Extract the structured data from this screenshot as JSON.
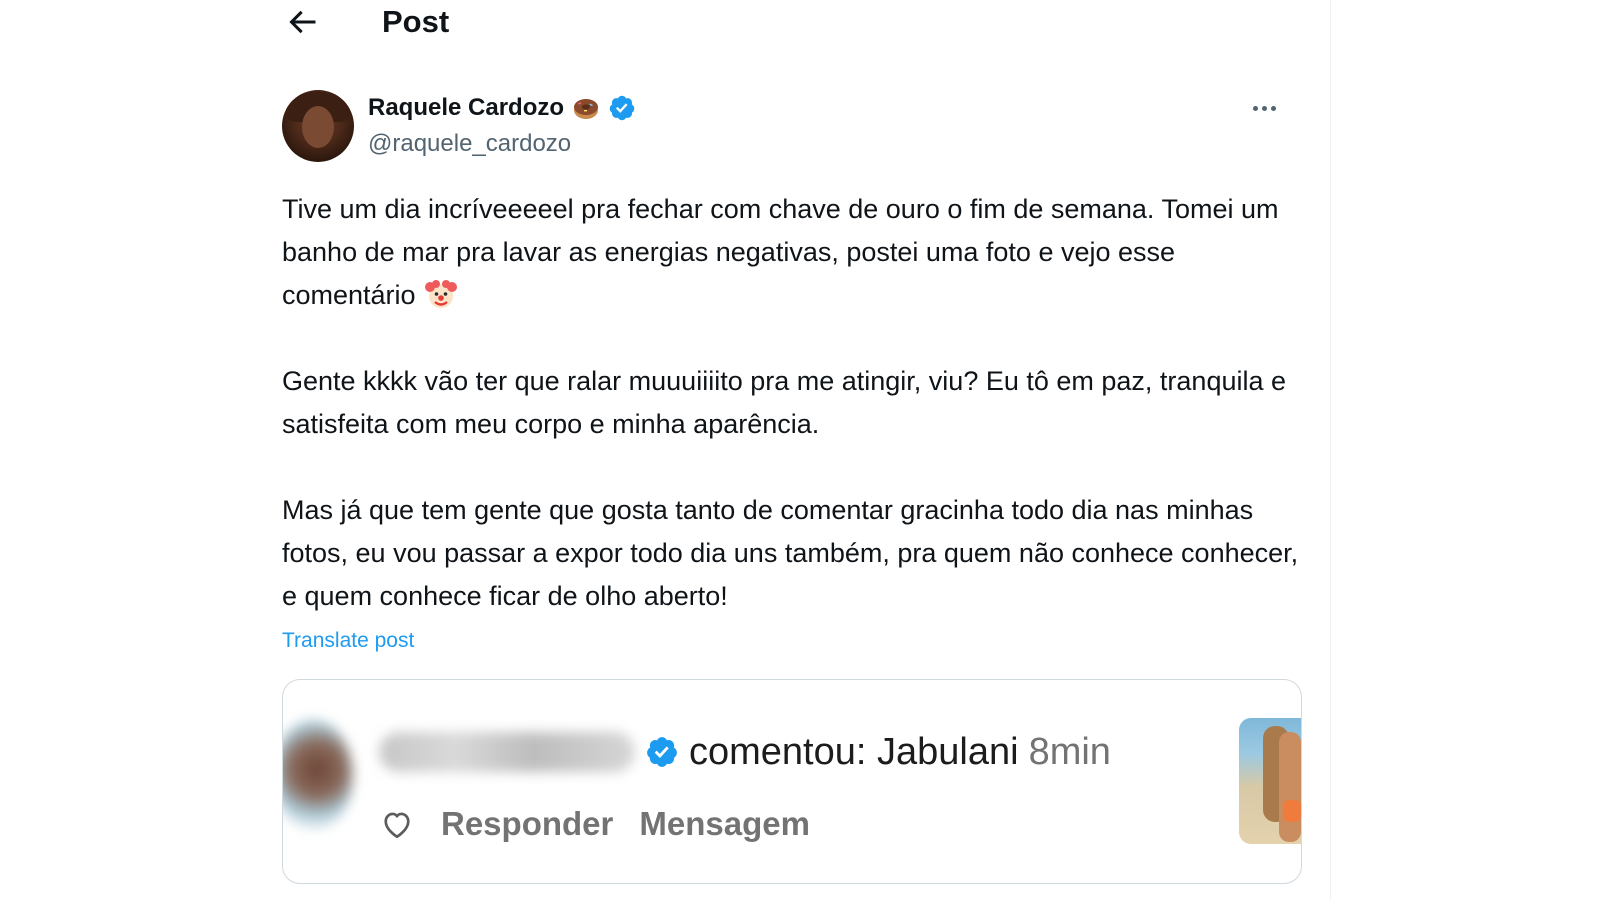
{
  "header": {
    "title": "Post",
    "back_icon": "arrow-left-icon"
  },
  "author": {
    "display_name": "Raquele Cardozo",
    "name_emoji": "donut-icon",
    "verified": true,
    "handle": "@raquele_cardozo",
    "more_icon": "more-horizontal-icon"
  },
  "post": {
    "paragraphs": [
      "Tive um dia incríveeeeel pra fechar com chave de ouro o fim de semana. Tomei um banho de mar pra lavar as energias negativas, postei uma foto e vejo esse comentário",
      "Gente kkkk vão ter que ralar muuuiiiito pra me atingir, viu? Eu tô em paz, tranquila e satisfeita com meu corpo e minha aparência.",
      "Mas já que tem gente que gosta tanto de comentar gracinha todo dia nas minhas fotos, eu vou passar a expor todo dia uns também, pra quem não conhece conhecer, e quem conhece ficar de olho aberto!"
    ],
    "trailing_emoji": "clown-face-icon",
    "translate_label": "Translate post"
  },
  "media": {
    "comment_text": "comentou: Jabulani",
    "comment_time": "8min",
    "username_blurred": true,
    "reply_label": "Responder",
    "message_label": "Mensagem",
    "like_icon": "heart-outline-icon"
  },
  "colors": {
    "link": "#1d9bf0",
    "verified": "#1d9bf0",
    "text_primary": "#0f1419",
    "text_secondary": "#536471",
    "instagram_secondary": "#737373",
    "border": "#cfd9de"
  }
}
